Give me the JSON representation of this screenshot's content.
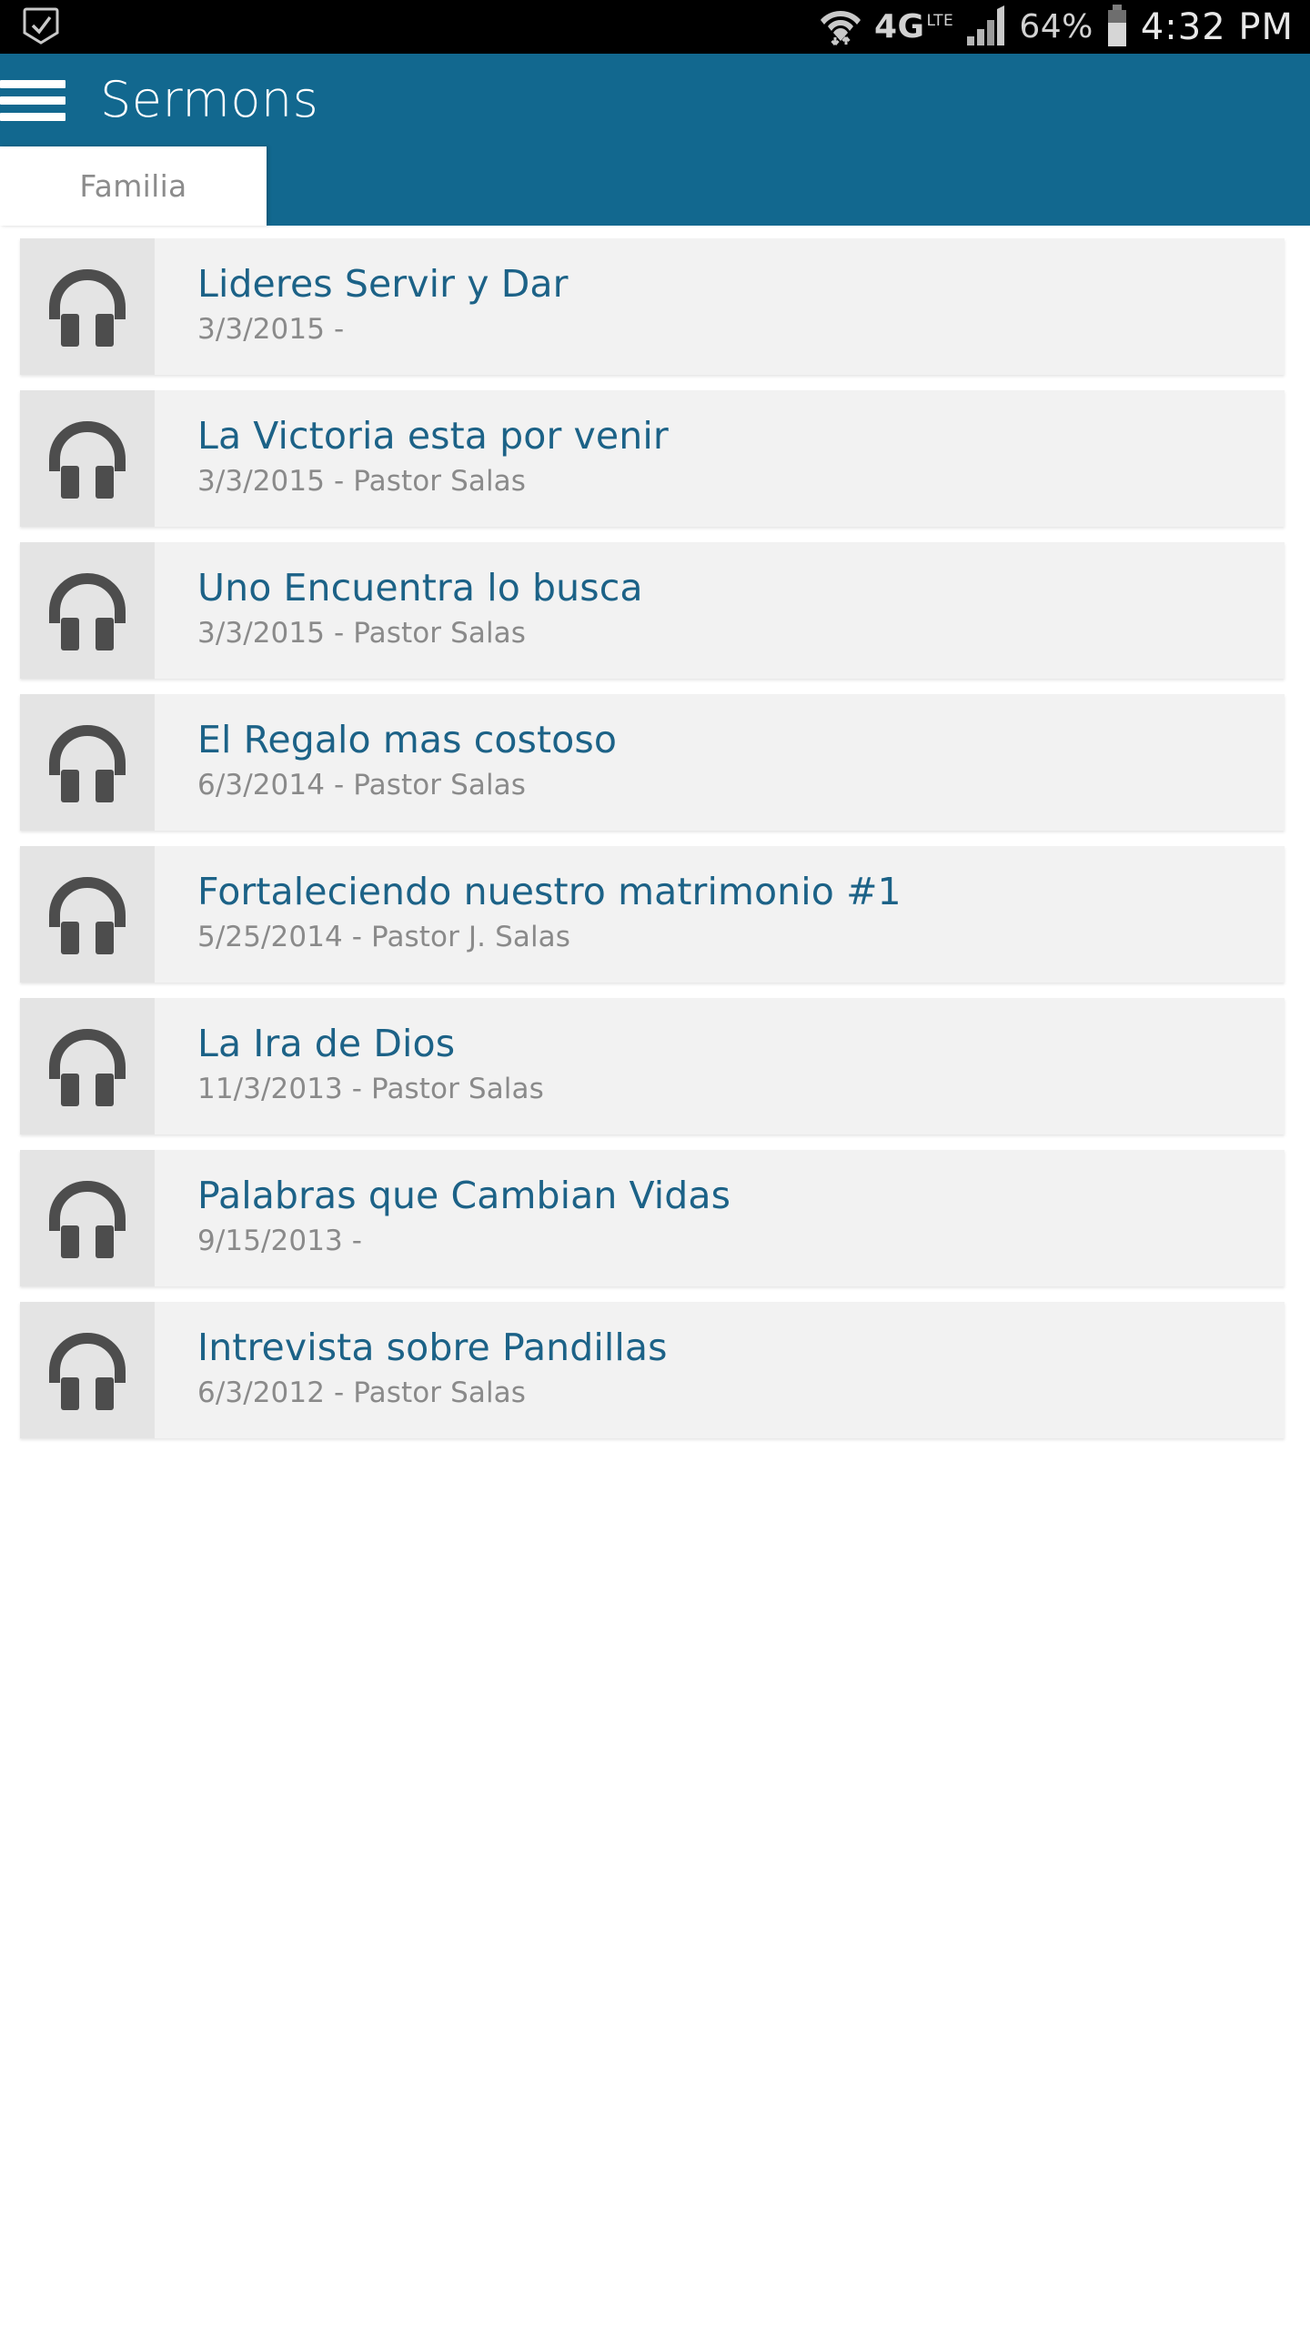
{
  "status_bar": {
    "left_icons": [
      "checkmark-box-icon"
    ],
    "wifi_icon": "wifi-icon",
    "network_label": "4G",
    "network_sub_label": "LTE",
    "signal_icon": "cellular-signal-icon",
    "battery_percent": "64%",
    "battery_icon": "battery-icon",
    "clock": "4:32 PM"
  },
  "app_bar": {
    "menu_icon": "hamburger-menu-icon",
    "title": "Sermons",
    "background_color": "#12688f"
  },
  "tabs": {
    "items": [
      {
        "label": "Familia",
        "selected": true
      }
    ]
  },
  "theme": {
    "accent": "#12688f",
    "title_link": "#1c6287",
    "subtitle": "#8a8a8a",
    "card_bg": "#f2f2f2",
    "thumb_bg": "#e4e4e4",
    "page_bg": "#ffffff"
  },
  "sermons": [
    {
      "icon": "headphones-icon",
      "title": "Lideres Servir y Dar",
      "meta": "3/3/2015 -"
    },
    {
      "icon": "headphones-icon",
      "title": "La Victoria esta por venir",
      "meta": "3/3/2015 - Pastor Salas"
    },
    {
      "icon": "headphones-icon",
      "title": "Uno Encuentra lo busca",
      "meta": "3/3/2015 - Pastor Salas"
    },
    {
      "icon": "headphones-icon",
      "title": "El Regalo mas costoso",
      "meta": "6/3/2014 - Pastor Salas"
    },
    {
      "icon": "headphones-icon",
      "title": "Fortaleciendo nuestro matrimonio #1",
      "meta": "5/25/2014 - Pastor J. Salas"
    },
    {
      "icon": "headphones-icon",
      "title": "La Ira de Dios",
      "meta": "11/3/2013 - Pastor Salas"
    },
    {
      "icon": "headphones-icon",
      "title": "Palabras que Cambian Vidas",
      "meta": "9/15/2013 -"
    },
    {
      "icon": "headphones-icon",
      "title": "Intrevista sobre Pandillas",
      "meta": "6/3/2012 - Pastor Salas"
    }
  ]
}
